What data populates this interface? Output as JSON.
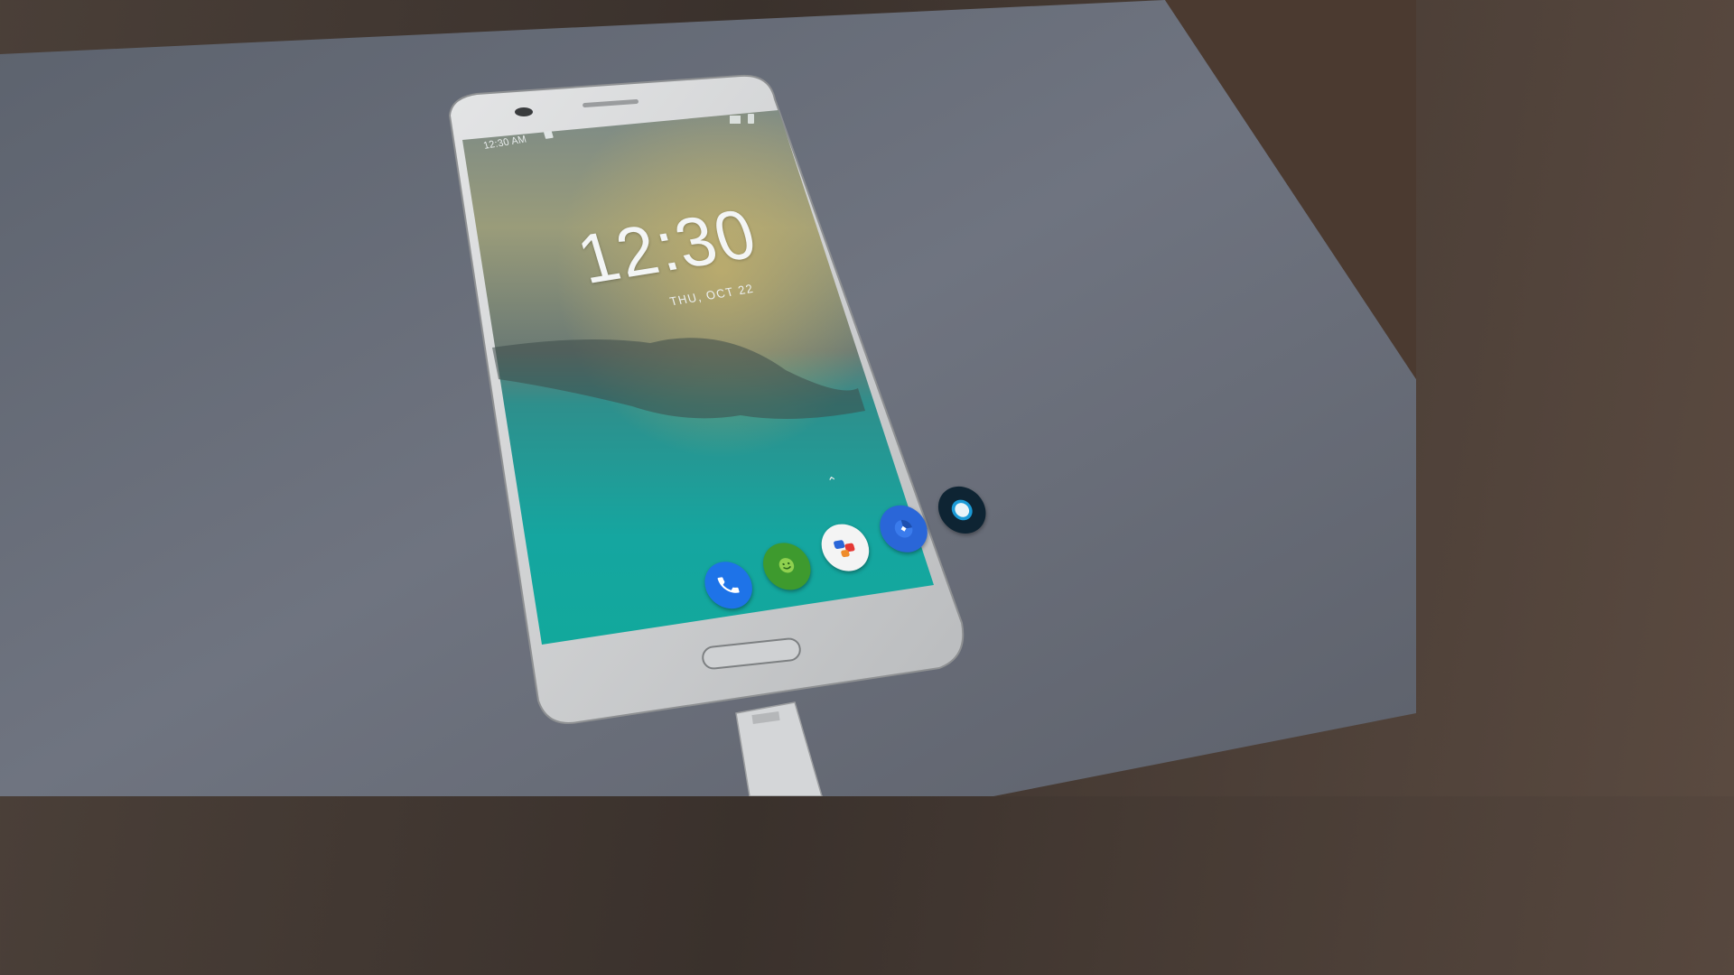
{
  "status_bar": {
    "time": "12:30 AM",
    "icons": [
      "sd-card-icon",
      "signal-icon",
      "battery-icon"
    ]
  },
  "lock_screen": {
    "clock": "12:30",
    "date": "THU, OCT 22",
    "swipe_hint_icon": "chevron-up-icon"
  },
  "dock": {
    "apps": [
      {
        "icon": "phone-icon",
        "color": "#1e73e8"
      },
      {
        "icon": "messaging-icon",
        "color": "#3e9a2e"
      },
      {
        "icon": "contacts-icon",
        "color": "#f4f4f4"
      },
      {
        "icon": "browser-icon",
        "color": "#2a66d8"
      },
      {
        "icon": "camera-icon",
        "color": "#0e2433"
      }
    ]
  },
  "colors": {
    "screen_top": "#7a8c8a",
    "screen_bottom": "#1aa8a0",
    "phone_body": "#d9dadb",
    "desk_surface": "#6a6f78"
  }
}
